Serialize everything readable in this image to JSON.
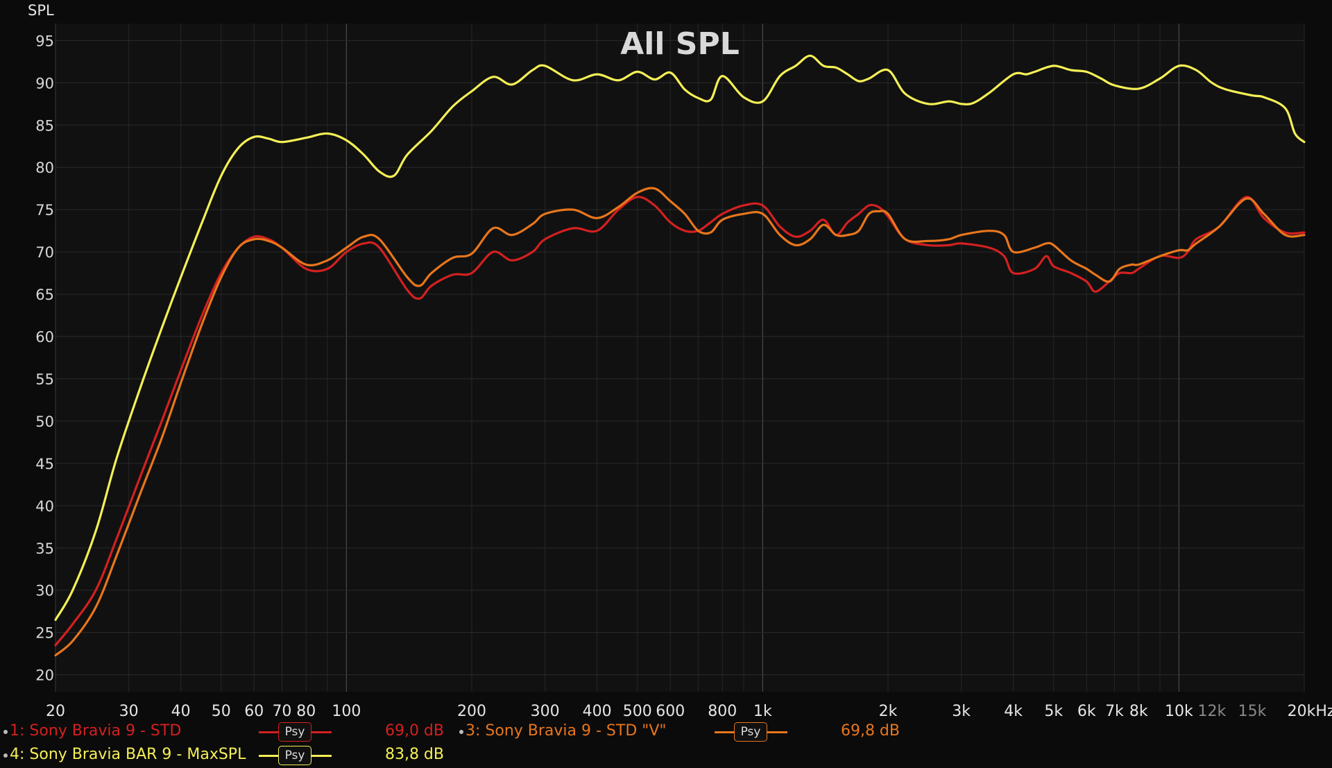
{
  "chart_data": {
    "type": "line",
    "title": "All SPL",
    "ylabel": "SPL",
    "xunit": "kHz",
    "xscale": "log",
    "xlim": [
      20,
      20000
    ],
    "ylim": [
      18,
      97
    ],
    "grid": true,
    "yticks": [
      20,
      25,
      30,
      35,
      40,
      45,
      50,
      55,
      60,
      65,
      70,
      75,
      80,
      85,
      90,
      95
    ],
    "xticks": [
      {
        "v": 20,
        "label": "20",
        "major": true
      },
      {
        "v": 30,
        "label": "30",
        "major": true
      },
      {
        "v": 40,
        "label": "40",
        "major": true
      },
      {
        "v": 50,
        "label": "50",
        "major": true
      },
      {
        "v": 60,
        "label": "60",
        "major": true
      },
      {
        "v": 70,
        "label": "70",
        "major": true
      },
      {
        "v": 80,
        "label": "80",
        "major": true
      },
      {
        "v": 100,
        "label": "100",
        "major": true
      },
      {
        "v": 200,
        "label": "200",
        "major": true
      },
      {
        "v": 300,
        "label": "300",
        "major": true
      },
      {
        "v": 400,
        "label": "400",
        "major": true
      },
      {
        "v": 500,
        "label": "500",
        "major": true
      },
      {
        "v": 600,
        "label": "600",
        "major": true
      },
      {
        "v": 800,
        "label": "800",
        "major": true
      },
      {
        "v": 1000,
        "label": "1k",
        "major": true
      },
      {
        "v": 2000,
        "label": "2k",
        "major": true
      },
      {
        "v": 3000,
        "label": "3k",
        "major": true
      },
      {
        "v": 4000,
        "label": "4k",
        "major": true
      },
      {
        "v": 5000,
        "label": "5k",
        "major": true
      },
      {
        "v": 6000,
        "label": "6k",
        "major": true
      },
      {
        "v": 7000,
        "label": "7k",
        "major": true
      },
      {
        "v": 8000,
        "label": "8k",
        "major": true
      },
      {
        "v": 10000,
        "label": "10k",
        "major": true
      },
      {
        "v": 12000,
        "label": "12k",
        "major": false
      },
      {
        "v": 15000,
        "label": "15k",
        "major": false
      },
      {
        "v": 20000,
        "label": "20kHz",
        "major": true
      }
    ],
    "series": [
      {
        "name": "1: Sony Bravia 9 - STD",
        "value": "69,0 dB",
        "color": "#d42020",
        "x": [
          20,
          22,
          25,
          28,
          32,
          36,
          40,
          45,
          50,
          55,
          60,
          65,
          70,
          80,
          90,
          100,
          110,
          120,
          140,
          150,
          160,
          180,
          200,
          225,
          250,
          280,
          300,
          350,
          400,
          450,
          500,
          550,
          600,
          650,
          700,
          750,
          800,
          900,
          1000,
          1100,
          1200,
          1300,
          1400,
          1500,
          1600,
          1700,
          1800,
          1900,
          2000,
          2200,
          2500,
          2800,
          3000,
          3500,
          3800,
          4000,
          4500,
          4800,
          5000,
          5500,
          6000,
          6300,
          6800,
          7200,
          7700,
          8000,
          9000,
          10000,
          10500,
          11000,
          12500,
          14500,
          16000,
          18000,
          20000
        ],
        "y": [
          23.5,
          26,
          30,
          36,
          43.5,
          50,
          56,
          62.5,
          67.5,
          70.5,
          71.8,
          71.5,
          70.5,
          68,
          68,
          70,
          71,
          70.5,
          65.5,
          64.5,
          66,
          67.3,
          67.5,
          70,
          69,
          70,
          71.5,
          72.8,
          72.5,
          75,
          76.5,
          75.5,
          73.5,
          72.5,
          72.5,
          73.5,
          74.5,
          75.5,
          75.5,
          73,
          71.8,
          72.5,
          73.8,
          72,
          73.5,
          74.5,
          75.5,
          75.3,
          74.2,
          71.5,
          70.8,
          70.8,
          71,
          70.5,
          69.5,
          67.5,
          68,
          69.5,
          68.3,
          67.5,
          66.5,
          65.3,
          66.5,
          67.5,
          67.5,
          68,
          69.5,
          69.3,
          70,
          71.5,
          73,
          76.5,
          74,
          72.3,
          72.3
        ]
      },
      {
        "name": "3: Sony Bravia 9 - STD \"V\"",
        "value": "69,8 dB",
        "color": "#e8761c",
        "x": [
          20,
          22,
          25,
          28,
          32,
          36,
          40,
          45,
          50,
          55,
          60,
          65,
          70,
          80,
          90,
          100,
          110,
          120,
          140,
          150,
          160,
          180,
          200,
          225,
          250,
          280,
          300,
          350,
          400,
          450,
          500,
          550,
          600,
          650,
          700,
          750,
          800,
          900,
          1000,
          1100,
          1200,
          1300,
          1400,
          1500,
          1600,
          1700,
          1800,
          1900,
          2000,
          2200,
          2500,
          2800,
          3000,
          3500,
          3800,
          4000,
          4500,
          4800,
          5000,
          5500,
          6000,
          6300,
          6800,
          7200,
          7700,
          8000,
          9000,
          10000,
          10500,
          11000,
          12500,
          14500,
          16000,
          18000,
          20000
        ],
        "y": [
          22.3,
          24,
          28,
          34,
          41.5,
          48,
          54.5,
          61.5,
          67,
          70.5,
          71.5,
          71.3,
          70.5,
          68.5,
          69,
          70.5,
          71.8,
          71.5,
          67,
          66,
          67.5,
          69.3,
          69.8,
          72.8,
          72,
          73.3,
          74.5,
          75,
          74,
          75.3,
          77,
          77.5,
          76,
          74.5,
          72.5,
          72.3,
          73.8,
          74.5,
          74.5,
          72,
          70.8,
          71.5,
          73.2,
          72,
          72,
          72.5,
          74.5,
          74.8,
          74.5,
          71.5,
          71.3,
          71.5,
          72,
          72.5,
          72,
          70,
          70.5,
          71,
          70.8,
          69,
          68,
          67.3,
          66.5,
          68,
          68.5,
          68.5,
          69.5,
          70.2,
          70.2,
          71,
          73,
          76.3,
          74.5,
          72,
          72
        ]
      },
      {
        "name": "4: Sony Bravia BAR 9 - MaxSPL",
        "value": "83,8 dB",
        "color": "#f5f056",
        "x": [
          20,
          22,
          25,
          28,
          32,
          36,
          40,
          45,
          50,
          55,
          60,
          65,
          70,
          80,
          90,
          100,
          110,
          120,
          130,
          140,
          160,
          180,
          200,
          225,
          250,
          280,
          300,
          350,
          400,
          450,
          500,
          550,
          600,
          650,
          700,
          750,
          800,
          900,
          1000,
          1100,
          1200,
          1300,
          1400,
          1500,
          1600,
          1700,
          1800,
          2000,
          2200,
          2500,
          2800,
          3000,
          3200,
          3500,
          4000,
          4300,
          4500,
          5000,
          5500,
          6000,
          6500,
          7000,
          8000,
          9000,
          10000,
          11000,
          12000,
          13000,
          15000,
          16000,
          18000,
          19000,
          20000
        ],
        "y": [
          26.5,
          30,
          37,
          45.5,
          54,
          61,
          67,
          73.5,
          79,
          82.3,
          83.6,
          83.4,
          83,
          83.5,
          84,
          83.2,
          81.5,
          79.5,
          79,
          81.5,
          84.3,
          87.2,
          89,
          90.7,
          89.8,
          91.5,
          92,
          90.3,
          91,
          90.3,
          91.3,
          90.4,
          91.2,
          89.2,
          88.2,
          88,
          90.8,
          88.3,
          87.8,
          90.8,
          92,
          93.2,
          92,
          91.8,
          91,
          90.2,
          90.5,
          91.5,
          88.7,
          87.5,
          87.8,
          87.5,
          87.6,
          88.8,
          91,
          91,
          91.3,
          92,
          91.5,
          91.3,
          90.5,
          89.7,
          89.3,
          90.5,
          92,
          91.5,
          90,
          89.2,
          88.5,
          88.3,
          87,
          84,
          83
        ]
      }
    ]
  }
}
